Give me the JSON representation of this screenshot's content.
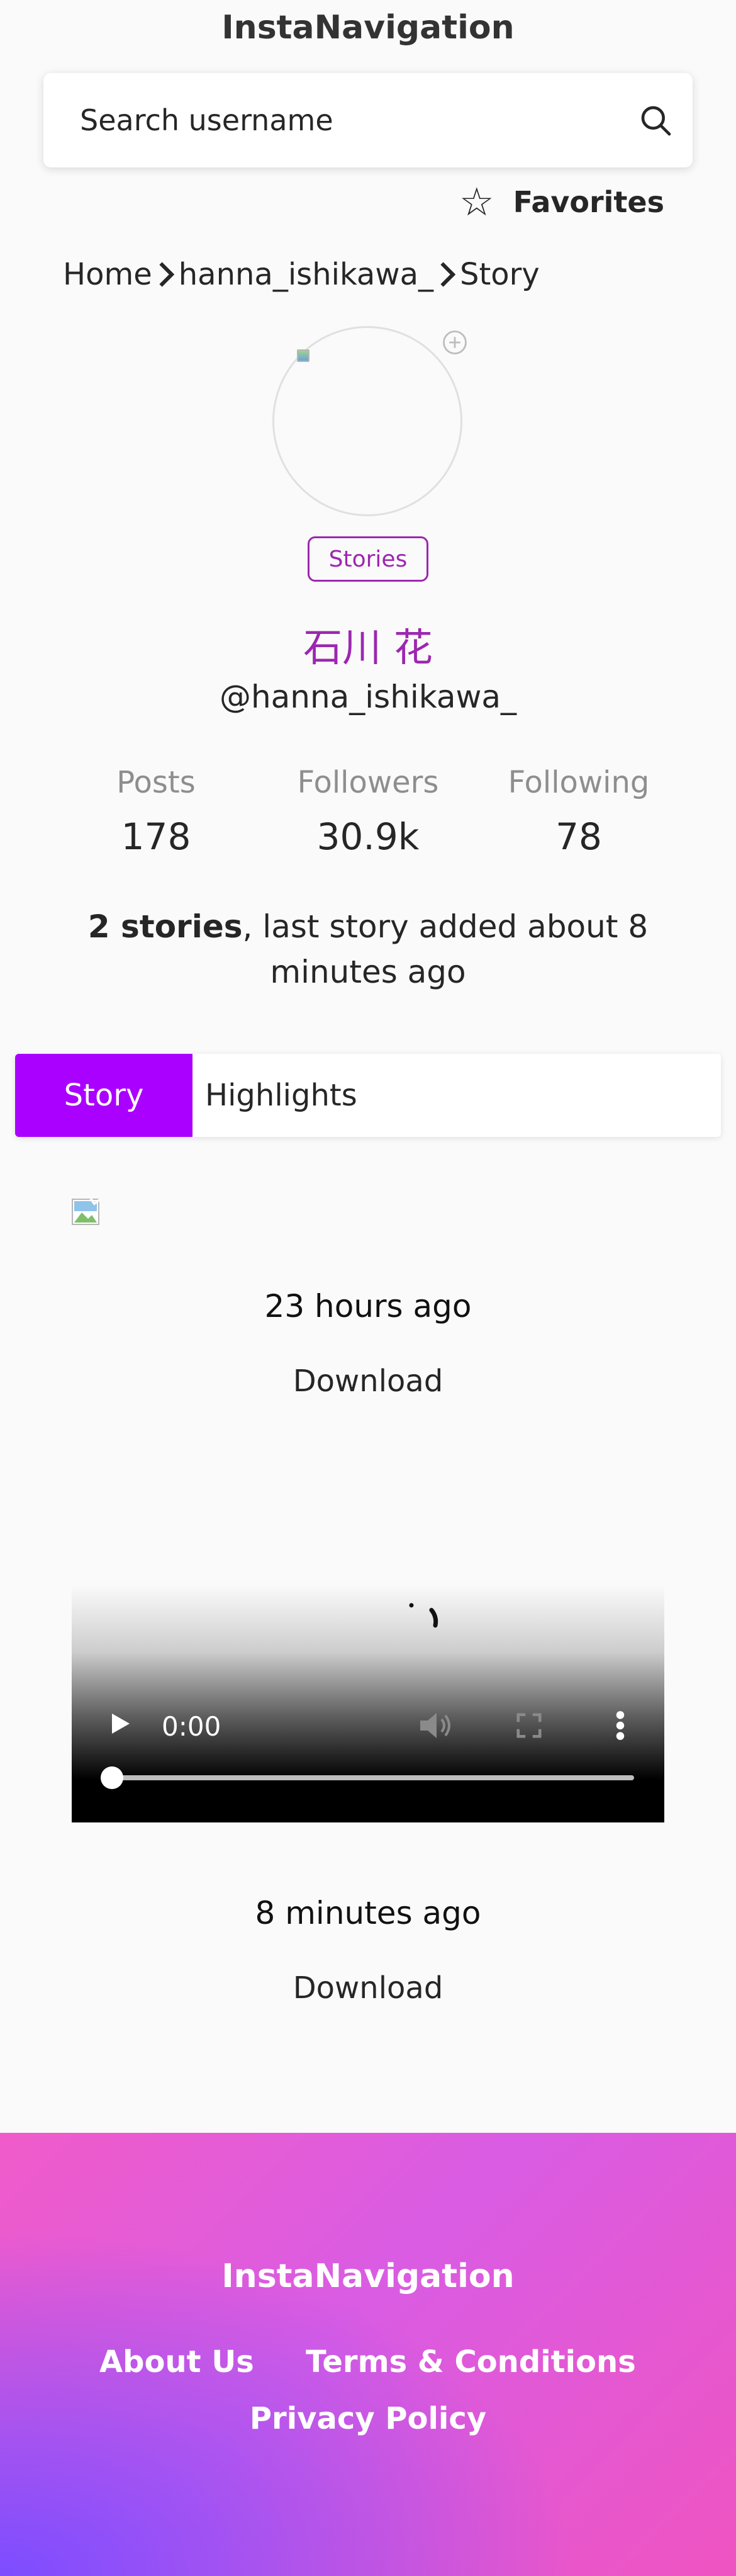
{
  "header": {
    "site_title": "InstaNavigation",
    "search_placeholder": "Search username",
    "favorites_label": "Favorites"
  },
  "breadcrumb": {
    "items": [
      "Home",
      "hanna_ishikawa_",
      "Story"
    ]
  },
  "profile": {
    "stories_badge": "Stories",
    "full_name": "石川 花",
    "username": "@hanna_ishikawa_",
    "stats": [
      {
        "label": "Posts",
        "value": "178"
      },
      {
        "label": "Followers",
        "value": "30.9k"
      },
      {
        "label": "Following",
        "value": "78"
      }
    ],
    "summary_bold": "2 stories",
    "summary_rest": ", last story added about 8 minutes ago"
  },
  "tabs": [
    {
      "label": "Story",
      "active": true
    },
    {
      "label": "Highlights",
      "active": false
    }
  ],
  "stories": [
    {
      "time": "23 hours ago",
      "download_label": "Download",
      "media": "image"
    },
    {
      "time": "8 minutes ago",
      "download_label": "Download",
      "media": "video",
      "video_time": "0:00"
    }
  ],
  "footer": {
    "brand": "InstaNavigation",
    "links": [
      "About Us",
      "Terms & Conditions",
      "Privacy Policy"
    ]
  },
  "colors": {
    "accent": "#9c27b0",
    "tab_active": "#aa00ff",
    "footer_pink": "#f05bc9",
    "footer_violet": "#7c4dff"
  }
}
